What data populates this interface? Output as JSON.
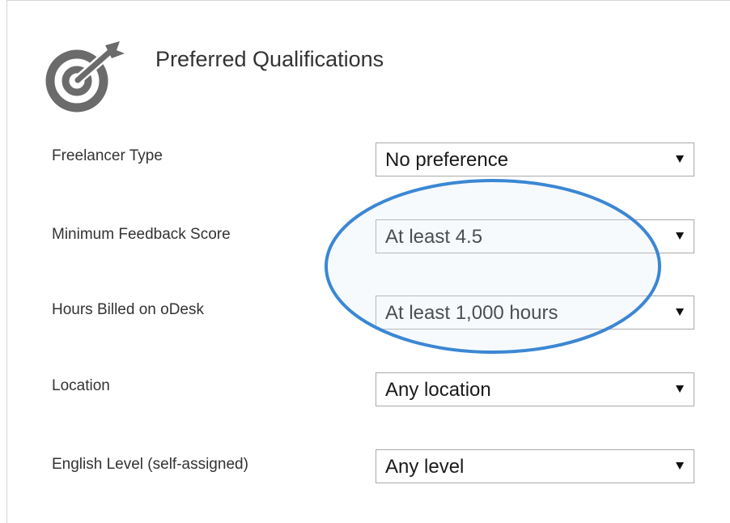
{
  "section": {
    "title": "Preferred Qualifications",
    "icon": "target-arrow-icon"
  },
  "rows": [
    {
      "label": "Freelancer Type",
      "value": "No preference"
    },
    {
      "label": "Minimum Feedback Score",
      "value": "At least 4.5"
    },
    {
      "label": "Hours Billed on oDesk",
      "value": "At least 1,000 hours"
    },
    {
      "label": "Location",
      "value": "Any location"
    },
    {
      "label": "English Level (self-assigned)",
      "value": "Any level"
    }
  ],
  "annotation": {
    "shape": "ellipse",
    "color": "#3b87d4",
    "highlights": [
      "Minimum Feedback Score",
      "Hours Billed on oDesk"
    ]
  },
  "colors": {
    "text": "#333333",
    "icon": "#6b6b6b",
    "border": "#aaaaaa"
  }
}
